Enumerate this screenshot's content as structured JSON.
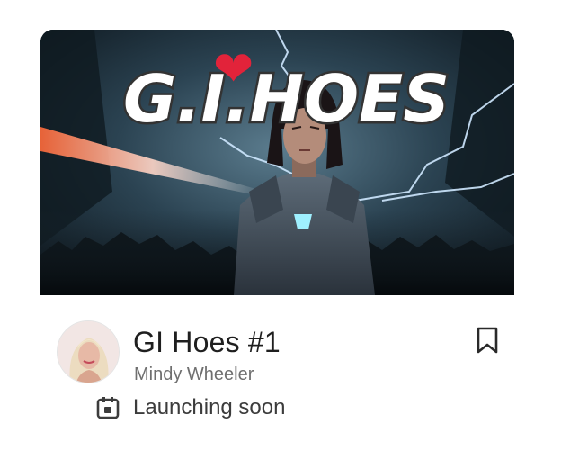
{
  "post": {
    "title": "GI Hoes #1",
    "author": "Mindy Wheeler",
    "status": "Launching soon"
  },
  "cover": {
    "logo_text": "G.I.HOES",
    "heart": "❤"
  },
  "icons": {
    "bookmark": "bookmark-icon",
    "calendar": "calendar-icon",
    "heart": "heart-icon"
  },
  "colors": {
    "title": "#1f1f1f",
    "author": "#6f6f6f",
    "status": "#3c3c3c",
    "heart": "#e2233a",
    "lightning": "#cfe8ff",
    "armor_light": "#9ff0ff"
  }
}
